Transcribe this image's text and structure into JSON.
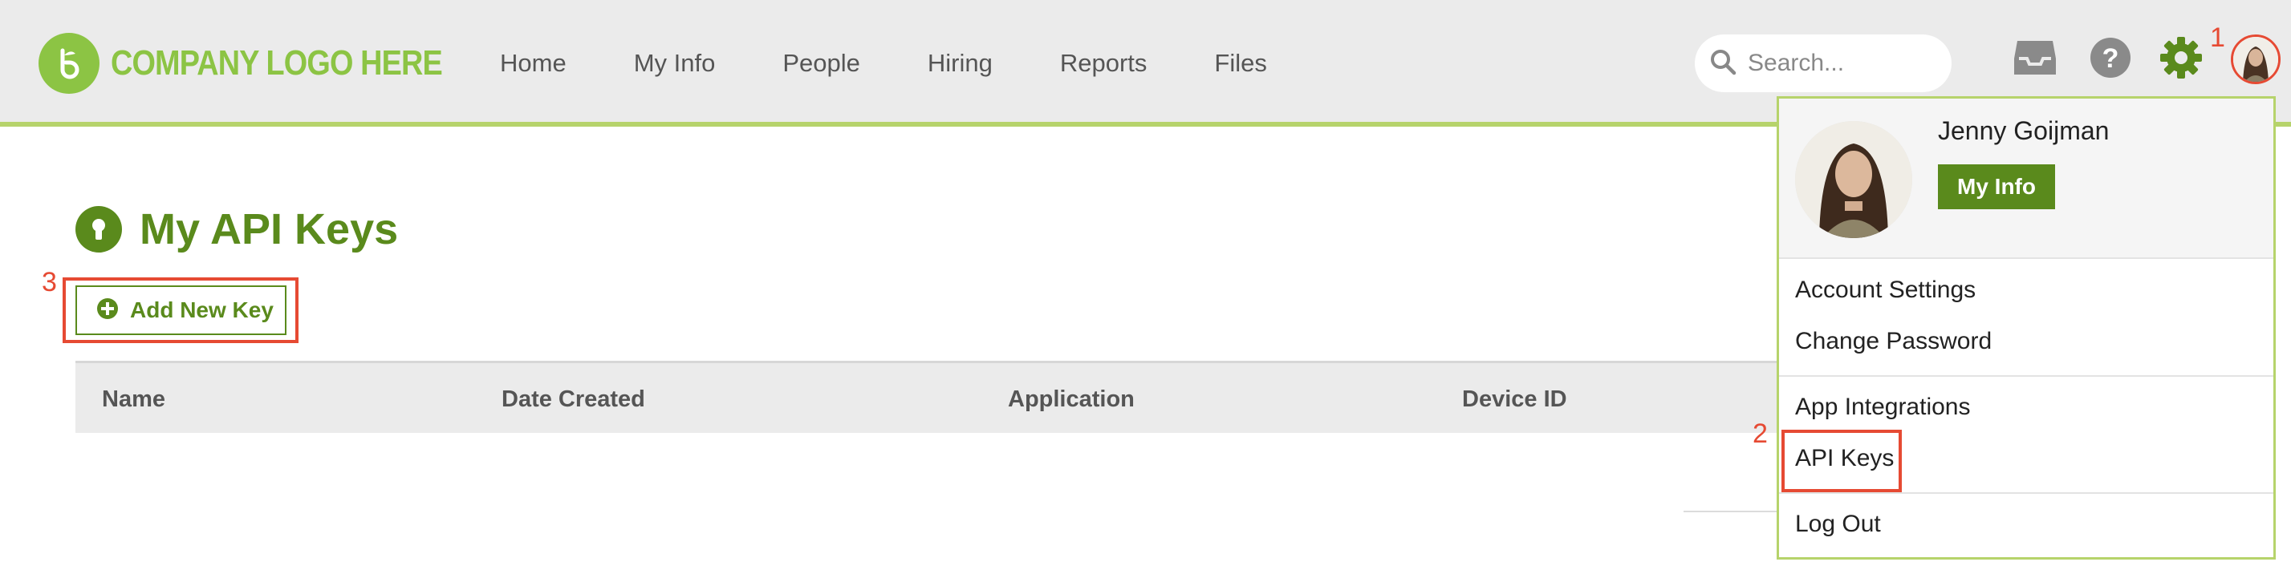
{
  "brand": {
    "logo_text": "COMPANY LOGO HERE",
    "accent": "#8cc444",
    "primary": "#5a8a1c",
    "highlight": "#e64a33"
  },
  "nav": {
    "items": [
      {
        "label": "Home"
      },
      {
        "label": "My Info"
      },
      {
        "label": "People"
      },
      {
        "label": "Hiring"
      },
      {
        "label": "Reports"
      },
      {
        "label": "Files"
      }
    ]
  },
  "search": {
    "placeholder": "Search..."
  },
  "toolbar": {
    "icons": [
      "inbox-icon",
      "help-icon",
      "gear-icon",
      "user-avatar"
    ]
  },
  "annotations": {
    "step1": "1",
    "step2": "2",
    "step3": "3"
  },
  "page": {
    "title": "My API Keys",
    "add_button_label": "Add New Key",
    "table": {
      "columns": [
        "Name",
        "Date Created",
        "Application",
        "Device ID"
      ]
    }
  },
  "user_menu": {
    "user_name": "Jenny Goijman",
    "my_info_label": "My Info",
    "items": [
      "Account Settings",
      "Change Password",
      "App Integrations",
      "API Keys",
      "Log Out"
    ]
  }
}
